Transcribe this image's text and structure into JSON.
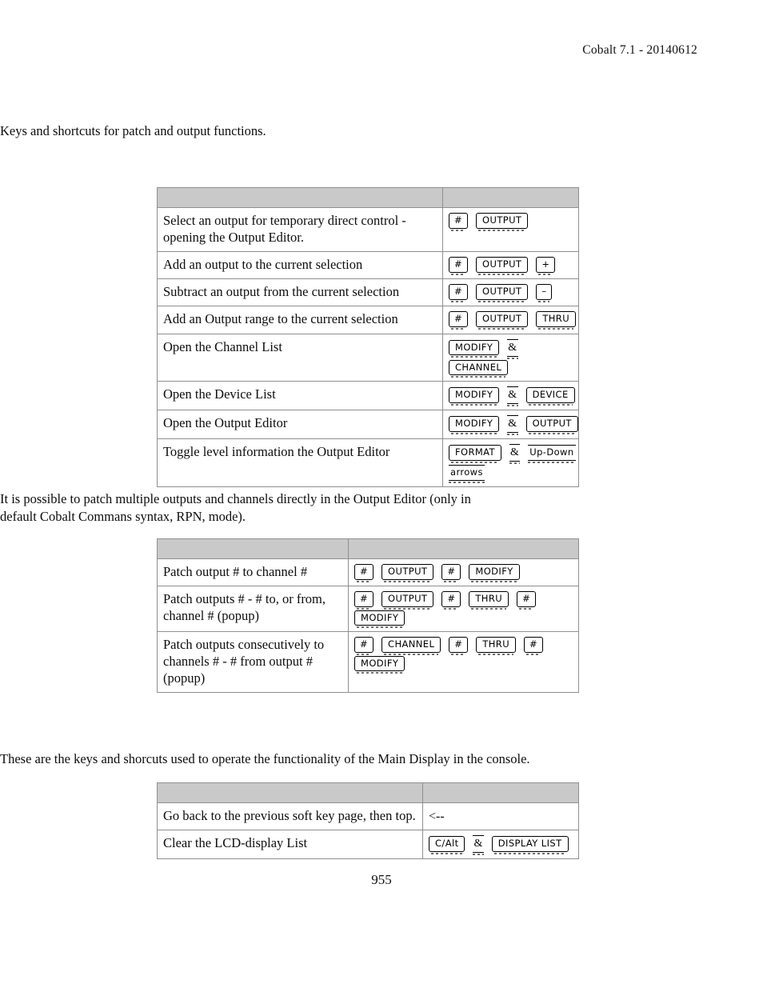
{
  "header": {
    "running_head": "Cobalt 7.1 - 20140612"
  },
  "intro_patch": "Keys and shortcuts for patch and output functions.",
  "intro_multi": "It is possible to patch multiple outputs and channels directly in the Output Editor (only in default Cobalt Commans syntax, RPN, mode).",
  "intro_display": "These are the keys and shorcuts used to operate the functionality of the Main Display in the console.",
  "tables": {
    "patch_output": {
      "header": {
        "col1": "",
        "col2": ""
      },
      "rows": [
        {
          "desc": "Select an output for temporary direct control - opening the Output Editor.",
          "lines": [
            [
              "#",
              "OUTPUT"
            ]
          ]
        },
        {
          "desc": "Add an output to the current selection",
          "lines": [
            [
              "#",
              "OUTPUT",
              "+"
            ]
          ]
        },
        {
          "desc": "Subtract an output from the current selection",
          "lines": [
            [
              "#",
              "OUTPUT",
              "–"
            ]
          ]
        },
        {
          "desc": "Add an Output range to the current selection",
          "lines": [
            [
              "#",
              "OUTPUT",
              "THRU"
            ]
          ]
        },
        {
          "desc": "Open the Channel List",
          "lines": [
            [
              "MODIFY",
              "&"
            ],
            [
              "CHANNEL"
            ]
          ]
        },
        {
          "desc": "Open the Device List",
          "lines": [
            [
              "MODIFY",
              "&",
              "DEVICE"
            ]
          ]
        },
        {
          "desc": "Open the Output Editor",
          "lines": [
            [
              "MODIFY",
              "&",
              "OUTPUT"
            ]
          ]
        },
        {
          "desc": "Toggle level information the Output Editor",
          "lines": [
            [
              "FORMAT",
              "&",
              "Up-Down"
            ],
            [
              "arrows"
            ]
          ]
        }
      ]
    },
    "patch_multi": {
      "header": {
        "col1": "",
        "col2": ""
      },
      "rows": [
        {
          "desc": "Patch output # to channel #",
          "lines": [
            [
              "#",
              "OUTPUT",
              "#",
              "MODIFY"
            ]
          ]
        },
        {
          "desc": "Patch outputs # - # to, or from, channel # (popup)",
          "lines": [
            [
              "#",
              "OUTPUT",
              "#",
              "THRU",
              "#"
            ],
            [
              "MODIFY"
            ]
          ]
        },
        {
          "desc": "Patch outputs consecutively to channels # - # from output # (popup)",
          "lines": [
            [
              "#",
              "CHANNEL",
              "#",
              "THRU",
              "#"
            ],
            [
              "MODIFY"
            ]
          ]
        }
      ]
    },
    "main_display": {
      "header": {
        "col1": "",
        "col2": ""
      },
      "rows": [
        {
          "desc": "Go back to the previous soft key page, then top.",
          "plain": "<--",
          "lines": []
        },
        {
          "desc": "Clear the LCD-display List",
          "lines": [
            [
              "C/Alt",
              "&",
              "DISPLAY LIST"
            ]
          ]
        }
      ]
    }
  },
  "folio": "955",
  "colors": {
    "table_header_fill": "#c9c9c9",
    "table_border": "#8f8f8f",
    "text": "#0d0d0d",
    "key_border": "#000000"
  }
}
